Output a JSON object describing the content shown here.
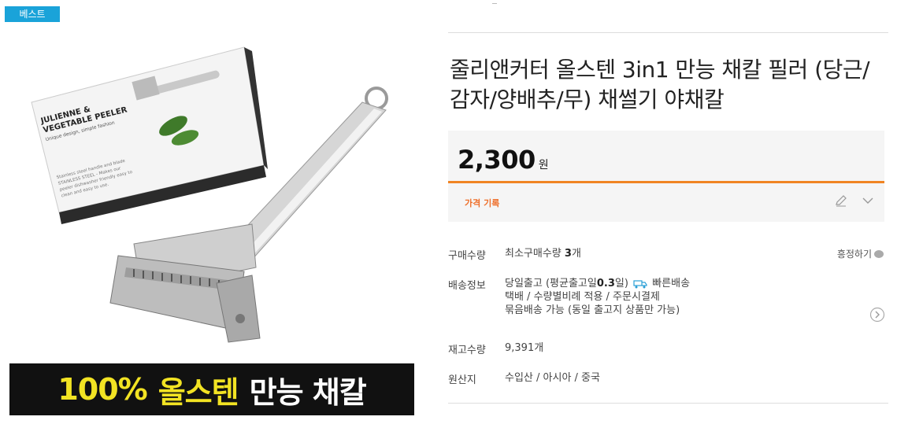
{
  "badge": "베스트",
  "banner": {
    "part1": "100%",
    "part2": "올스텐",
    "part3": "만능 채칼"
  },
  "product": {
    "title": "줄리앤커터 올스텐 3in1 만능 채칼 필러 (당근/감자/양배추/무) 채썰기 야채칼",
    "price": "2,300",
    "currency": "원"
  },
  "price_history": {
    "label": "가격 기록"
  },
  "purchase": {
    "label": "구매수량",
    "text": "최소구매수량 ",
    "qty": "3",
    "unit": "개",
    "negotiate": "흥정하기"
  },
  "shipping": {
    "label": "배송정보",
    "line1_a": "당일출고 (평균출고일",
    "line1_b": "0.3",
    "line1_c": "일)",
    "line1_fast": "빠른배송",
    "line2": "택배 / 수량별비례 적용 / 주문시결제",
    "line3": "묶음배송 가능 (동일 출고지 상품만 가능)"
  },
  "stock": {
    "label": "재고수량",
    "value": "9,391개"
  },
  "origin": {
    "label": "원산지",
    "value": "수입산 / 아시아 / 중국"
  },
  "box_text": {
    "l1": "JULIENNE &",
    "l2": "VEGETABLE PEELER",
    "l3": "Unique design, simple fashion",
    "l4": "Stainless steel handle and blade",
    "l5": "STAINLESS STEEL - Makes our",
    "l6": "peeler dishwasher friendly easy to",
    "l7": "clean and easy to use."
  },
  "colors": {
    "accent": "#f08423",
    "badge": "#1aa3d9",
    "banner_yellow": "#f2e323"
  }
}
